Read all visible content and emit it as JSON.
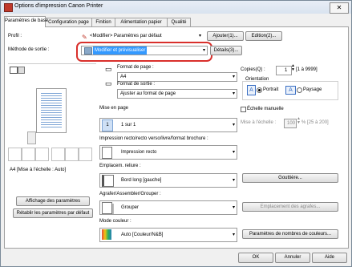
{
  "window": {
    "title": "Options d'impression Canon Printer",
    "close_glyph": "✕"
  },
  "tabs": [
    "Paramètres de base",
    "Configuration page",
    "Finition",
    "Alimentation papier",
    "Qualité"
  ],
  "profile": {
    "label": "Profil :",
    "value": "<Modifier> Paramètres par défaut",
    "add_button": "Ajouter(1)...",
    "edit_button": "Edition(2)..."
  },
  "output": {
    "label": "Méthode de sortie :",
    "value": "Modifier et prévisualiser",
    "details_button": "Détails(3)..."
  },
  "preview": {
    "caption": "A4 [Mise à l'échelle : Auto]",
    "show_settings_button": "Affichage des paramètres",
    "restore_button": "Rétablir les paramètres par défaut"
  },
  "page_size": {
    "label": "Format de page :",
    "value": "A4"
  },
  "output_size": {
    "label": "Format de sortie :",
    "value": "Ajuster au format de page"
  },
  "copies": {
    "label": "Copies(Q) :",
    "value": "1",
    "range": "[1 à 9999]"
  },
  "orientation": {
    "label": "Orientation",
    "portrait": "Portrait",
    "landscape": "Paysage"
  },
  "layout": {
    "label": "Mise en page",
    "value": "1 sur 1"
  },
  "manual_scaling": {
    "label": "Échelle manuelle",
    "scale_label": "Mise à l'échelle :",
    "scale_value": "100",
    "scale_range": "% [25 à 200]"
  },
  "duplex": {
    "label": "Impression recto/recto verso/livre/format brochure :",
    "value": "Impression recto"
  },
  "binding": {
    "label": "Emplacem. reliure :",
    "value": "Bord long [gauche]",
    "gutter_button": "Gouttière..."
  },
  "collate": {
    "label": "Agrafer/Assembler/Grouper :",
    "value": "Grouper",
    "staple_button": "Emplacement des agrafes..."
  },
  "color": {
    "label": "Mode couleur :",
    "value": "Auto [Couleur/N&B]",
    "color_button": "Paramètres de nombres de couleurs..."
  },
  "footer": {
    "ok": "OK",
    "cancel": "Annuler",
    "help": "Aide"
  },
  "colors": {
    "highlight_ring": "#d9302c",
    "selected": "#3399ff"
  }
}
